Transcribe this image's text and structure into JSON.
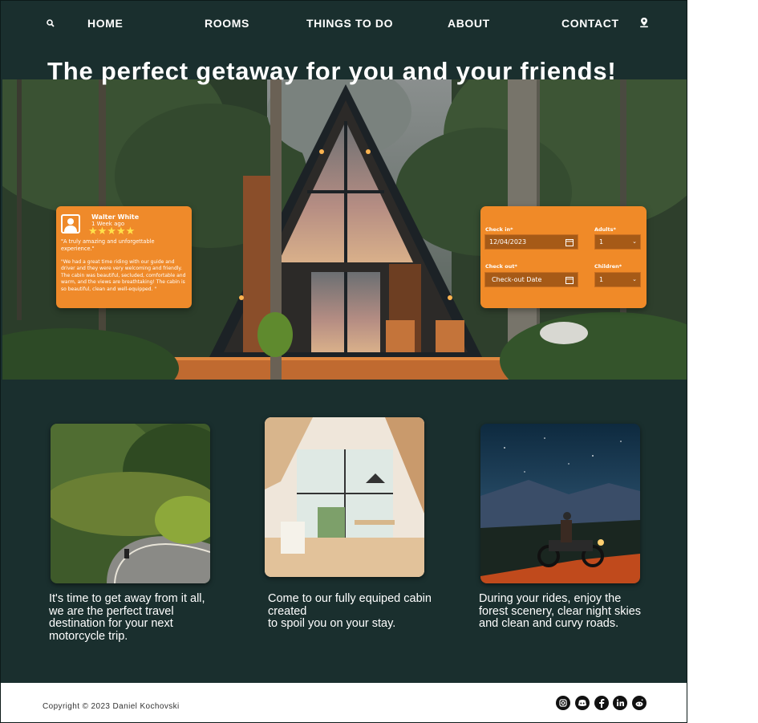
{
  "nav": {
    "home": "HOME",
    "rooms": "ROOMS",
    "things_to_do": "THINGS TO DO",
    "about": "ABOUT",
    "contact": "CONTACT",
    "left_icon": "search-icon",
    "right_icon": "location-pin-icon"
  },
  "hero": {
    "headline": "The perfect getaway for you and your friends!"
  },
  "review": {
    "name": "Walter White",
    "time": "1 Week ago",
    "stars": "★★★★★",
    "rating": 5,
    "quote": "\"A truly amazing and unforgettable experience.\"",
    "body": "\"We had a great time riding with our guide and driver and they were very welcoming and friendly. The cabin was beautiful, secluded, comfortable and warm, and the views are breathtaking! The cabin is so beautiful, clean and well-equipped. \""
  },
  "booking": {
    "checkin_label": "Check in*",
    "checkin_value": "12/04/2023",
    "checkout_label": "Check out*",
    "checkout_placeholder": "Check-out Date",
    "adults_label": "Adults*",
    "adults_value": "1",
    "children_label": "Children*",
    "children_value": "1"
  },
  "cards": [
    {
      "text": "It's time to get away from it all, we are the perfect travel destination for your next motorcycle trip."
    },
    {
      "text": "Come to our fully equiped cabin created\nto spoil you on your stay."
    },
    {
      "text": "During your rides, enjoy the forest scenery, clear night skies and clean and curvy roads."
    }
  ],
  "footer": {
    "copyright": "Copyright © 2023 Daniel Kochovski",
    "social": [
      "instagram-icon",
      "discord-icon",
      "facebook-icon",
      "linkedin-icon",
      "reddit-icon"
    ]
  },
  "colors": {
    "background": "#1a2f2e",
    "accent": "#f08a28",
    "star": "#ffe14a"
  }
}
